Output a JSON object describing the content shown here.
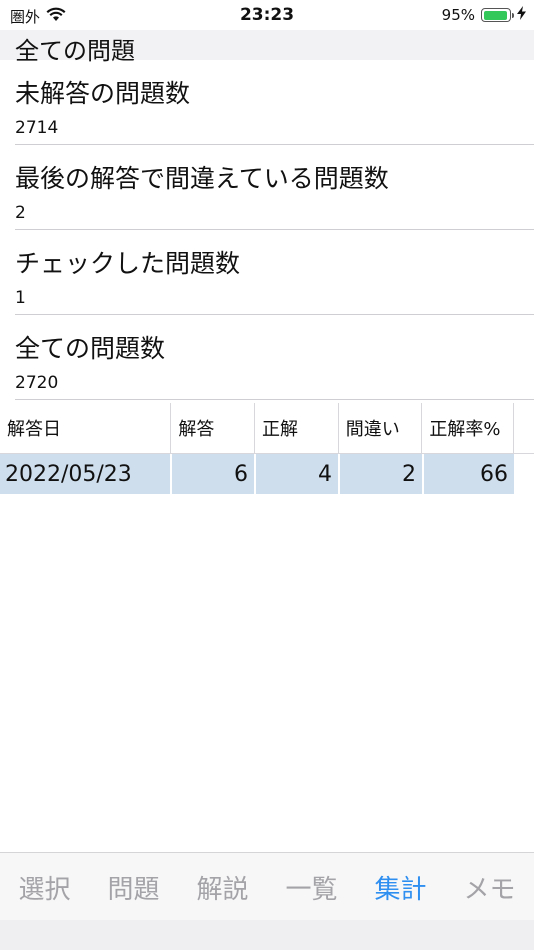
{
  "status_bar": {
    "carrier": "圏外",
    "time": "23:23",
    "battery_percent": "95%",
    "battery_level": 0.95,
    "icons": [
      "wifi-icon",
      "battery-icon",
      "charging-bolt-icon"
    ]
  },
  "section": {
    "title": "全ての問題"
  },
  "stats": [
    {
      "label": "未解答の問題数",
      "value": "2714"
    },
    {
      "label": "最後の解答で間違えている問題数",
      "value": "2"
    },
    {
      "label": "チェックした問題数",
      "value": "1"
    },
    {
      "label": "全ての問題数",
      "value": "2720"
    }
  ],
  "table": {
    "headers": [
      "解答日",
      "解答",
      "正解",
      "間違い",
      "正解率%"
    ],
    "rows": [
      [
        "2022/05/23",
        "6",
        "4",
        "2",
        "66"
      ]
    ]
  },
  "tabbar": {
    "tabs": [
      "選択",
      "問題",
      "解説",
      "一覧",
      "集計",
      "メモ"
    ],
    "active_index": 4,
    "active_color": "#2f8ff0"
  }
}
